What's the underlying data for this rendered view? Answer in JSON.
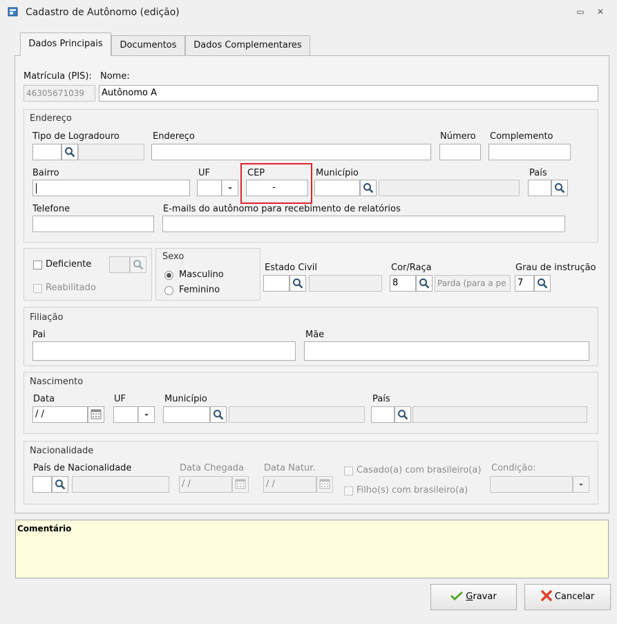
{
  "window": {
    "title": "Cadastro de Autônomo (edição)",
    "restore_glyph": "▭",
    "close_glyph": "✕"
  },
  "tabs": [
    {
      "label": "Dados Principais"
    },
    {
      "label": "Documentos"
    },
    {
      "label": "Dados Complementares"
    }
  ],
  "main": {
    "matricula_label": "Matrícula (PIS):",
    "matricula_value": "46305671039",
    "nome_label": "Nome:",
    "nome_value": "Autônomo A"
  },
  "endereco": {
    "group_title": "Endereço",
    "tipo_logradouro_label": "Tipo de Logradouro",
    "endereco_label": "Endereço",
    "numero_label": "Número",
    "complemento_label": "Complemento",
    "bairro_label": "Bairro",
    "uf_label": "UF",
    "cep_label": "CEP",
    "cep_value": "-",
    "municipio_label": "Município",
    "pais_label": "País",
    "telefone_label": "Telefone",
    "emails_label": "E-mails do autônomo para recebimento de relatórios"
  },
  "pessoal": {
    "deficiente_label": "Deficiente",
    "reabilitado_label": "Reabilitado",
    "sexo_title": "Sexo",
    "masculino_label": "Masculino",
    "feminino_label": "Feminino",
    "estado_civil_label": "Estado Civil",
    "cor_raca_label": "Cor/Raça",
    "cor_raca_code": "8",
    "cor_raca_desc": "Parda (para a pe",
    "grau_instrucao_label": "Grau de instrução",
    "grau_instrucao_code": "7"
  },
  "filiacao": {
    "group_title": "Filiação",
    "pai_label": "Pai",
    "mae_label": "Mãe"
  },
  "nascimento": {
    "group_title": "Nascimento",
    "data_label": "Data",
    "data_value": " / /",
    "uf_label": "UF",
    "municipio_label": "Município",
    "pais_label": "País"
  },
  "nacionalidade": {
    "group_title": "Nacionalidade",
    "pais_label": "País de Nacionalidade",
    "data_chegada_label": "Data Chegada",
    "data_chegada_value": " / /",
    "data_natur_label": "Data Natur.",
    "data_natur_value": " / /",
    "casado_label": "Casado(a) com brasileiro(a)",
    "filhos_label": "Filho(s) com brasileiro(a)",
    "condicao_label": "Condição:"
  },
  "comentario": {
    "label": "Comentário"
  },
  "buttons": {
    "gravar_accel": "G",
    "gravar_rest": "ravar",
    "cancelar_label": "Cancelar"
  },
  "colors": {
    "highlight": "#e0242b",
    "comment_bg": "#fefedf",
    "check_green": "#5aa832",
    "cancel_red": "#d9432b"
  }
}
